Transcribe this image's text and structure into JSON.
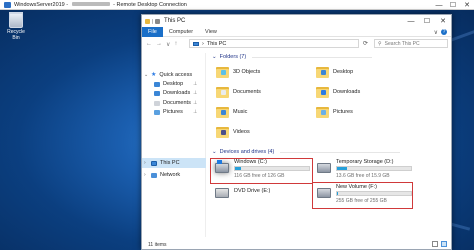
{
  "rdp": {
    "title_prefix": "WindowsServer2019 - ",
    "title_suffix": " - Remote Desktop Connection",
    "minimize_glyph": "—",
    "maximize_glyph": "☐",
    "close_glyph": "✕"
  },
  "desktop": {
    "recycle_bin_label": "Recycle Bin"
  },
  "explorer": {
    "title": "This PC",
    "ribbon_tabs": [
      "File",
      "Computer",
      "View"
    ],
    "address_path": "This PC",
    "search_placeholder": "Search This PC",
    "nav_back": "←",
    "nav_forward": "→",
    "nav_up": "↑",
    "refresh_glyph": "⟳",
    "expand_glyph": "∨",
    "help_glyph": "?",
    "nav_pane": {
      "quick_access": "Quick access",
      "pinned": [
        "Desktop",
        "Downloads",
        "Documents",
        "Pictures"
      ],
      "this_pc": "This PC",
      "network": "Network"
    },
    "folders_header": "Folders (7)",
    "folders": [
      "3D Objects",
      "Desktop",
      "Documents",
      "Downloads",
      "Music",
      "Pictures",
      "Videos"
    ],
    "drives_header": "Devices and drives (4)",
    "drives": [
      {
        "name": "Windows (C:)",
        "free_text": "116 GB free of 126 GB",
        "used_fraction": 0.08
      },
      {
        "name": "Temporary Storage (D:)",
        "free_text": "13.6 GB free of 15.9 GB",
        "used_fraction": 0.14
      },
      {
        "name": "DVD Drive (E:)",
        "free_text": "",
        "used_fraction": 0
      },
      {
        "name": "New Volume (F:)",
        "free_text": "255 GB free of 255 GB",
        "used_fraction": 0.01
      }
    ],
    "status_items": "11 items"
  },
  "colors": {
    "accent": "#1a6fc8",
    "drive_bar": "#26a0da",
    "highlight": "#d0393a",
    "folder": "#e8b83d"
  }
}
